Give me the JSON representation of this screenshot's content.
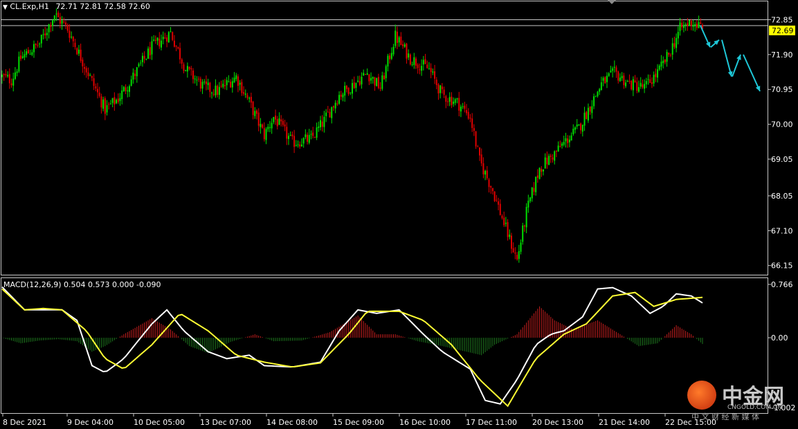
{
  "colors": {
    "background": "#000000",
    "frame": "#c8c8c8",
    "bull": "#00e000",
    "bear": "#e00000",
    "macd_line": "#ffffff",
    "signal_line": "#ffff33",
    "hist_pos": "#c81e1e",
    "hist_neg": "#1e781e",
    "price_tag": "#ffff00",
    "arrow": "#1ec8d8",
    "hline": "#c8c8c8"
  },
  "price_panel": {
    "symbol_label": "CL.Exp,H1",
    "ohlc_text": "72.71 72.81 72.58 72.60",
    "current_price": "72.69",
    "y_ticks": [
      "72.85",
      "71.90",
      "70.95",
      "70.00",
      "69.05",
      "68.05",
      "67.10",
      "66.15"
    ],
    "icons": {
      "menu": "triangle-down-icon"
    }
  },
  "macd_panel": {
    "label": "MACD(12,26,9) 0.504 0.573 0.000 -0.090",
    "y_ticks": [
      "0.766",
      "0.00",
      "-1.002"
    ]
  },
  "x_axis": {
    "ticks": [
      "8 Dec 2021",
      "9 Dec 04:00",
      "10 Dec 05:00",
      "13 Dec 07:00",
      "14 Dec 08:00",
      "15 Dec 09:00",
      "16 Dec 10:00",
      "17 Dec 11:00",
      "20 Dec 13:00",
      "21 Dec 14:00",
      "22 Dec 15:00"
    ]
  },
  "watermark": {
    "brand": "中金网",
    "domain": "CNGOLD.COM.CN",
    "tagline": "中 文 财 经 新 媒 体"
  },
  "chart_data": [
    {
      "type": "candlestick",
      "title": "CL.Exp,H1",
      "timeframe": "H1",
      "ylim": [
        65.9,
        73.35
      ],
      "x_labels": [
        "8 Dec 2021",
        "9 Dec 04:00",
        "10 Dec 05:00",
        "13 Dec 07:00",
        "14 Dec 08:00",
        "15 Dec 09:00",
        "16 Dec 10:00",
        "17 Dec 11:00",
        "20 Dec 13:00",
        "21 Dec 14:00",
        "22 Dec 15:00"
      ],
      "last_ohlc": {
        "open": 72.71,
        "high": 72.81,
        "low": 72.58,
        "close": 72.6
      },
      "horizontal_lines": [
        72.85,
        72.69
      ],
      "close_path": [
        [
          0,
          71.3
        ],
        [
          5,
          71.2
        ],
        [
          10,
          71.8
        ],
        [
          20,
          72.2
        ],
        [
          28,
          73.0
        ],
        [
          35,
          72.6
        ],
        [
          45,
          71.5
        ],
        [
          55,
          70.4
        ],
        [
          62,
          70.7
        ],
        [
          70,
          71.3
        ],
        [
          80,
          72.1
        ],
        [
          90,
          72.5
        ],
        [
          98,
          71.5
        ],
        [
          108,
          71.0
        ],
        [
          115,
          70.9
        ],
        [
          125,
          71.3
        ],
        [
          132,
          70.6
        ],
        [
          140,
          69.7
        ],
        [
          145,
          70.2
        ],
        [
          155,
          69.5
        ],
        [
          165,
          69.6
        ],
        [
          172,
          70.1
        ],
        [
          180,
          70.8
        ],
        [
          188,
          71.1
        ],
        [
          195,
          71.4
        ],
        [
          202,
          71.0
        ],
        [
          210,
          72.4
        ],
        [
          218,
          71.8
        ],
        [
          228,
          71.5
        ],
        [
          235,
          70.8
        ],
        [
          243,
          70.6
        ],
        [
          250,
          70.2
        ],
        [
          255,
          69.0
        ],
        [
          262,
          68.2
        ],
        [
          270,
          67.0
        ],
        [
          275,
          66.3
        ],
        [
          280,
          67.6
        ],
        [
          287,
          68.8
        ],
        [
          295,
          69.2
        ],
        [
          302,
          69.6
        ],
        [
          308,
          69.9
        ],
        [
          313,
          70.4
        ],
        [
          320,
          71.1
        ],
        [
          327,
          71.4
        ],
        [
          335,
          71.1
        ],
        [
          343,
          71.0
        ],
        [
          350,
          71.4
        ],
        [
          356,
          71.9
        ],
        [
          362,
          72.6
        ],
        [
          368,
          72.8
        ],
        [
          373,
          72.65
        ]
      ],
      "forecast_arrows": [
        [
          [
            72.69,
            72.1
          ],
          [
            72.1,
            72.3
          ]
        ],
        [
          [
            72.3,
            71.3
          ],
          [
            71.3,
            71.9
          ]
        ],
        [
          [
            71.9,
            70.9
          ]
        ]
      ]
    },
    {
      "type": "macd",
      "title": "MACD(12,26,9)",
      "params": [
        12,
        26,
        9
      ],
      "values": {
        "macd": 0.504,
        "signal": 0.573,
        "histogram": 0.0,
        "extra": -0.09
      },
      "ylim": [
        -1.002,
        0.766
      ],
      "macd_path": [
        [
          0,
          0.73
        ],
        [
          12,
          0.4
        ],
        [
          22,
          0.4
        ],
        [
          32,
          0.4
        ],
        [
          40,
          0.25
        ],
        [
          48,
          -0.4
        ],
        [
          55,
          -0.5
        ],
        [
          65,
          -0.3
        ],
        [
          80,
          0.2
        ],
        [
          88,
          0.4
        ],
        [
          97,
          0.1
        ],
        [
          110,
          -0.2
        ],
        [
          120,
          -0.3
        ],
        [
          132,
          -0.25
        ],
        [
          140,
          -0.4
        ],
        [
          155,
          -0.42
        ],
        [
          170,
          -0.35
        ],
        [
          180,
          0.1
        ],
        [
          190,
          0.4
        ],
        [
          200,
          0.35
        ],
        [
          212,
          0.4
        ],
        [
          225,
          0.05
        ],
        [
          235,
          -0.2
        ],
        [
          250,
          -0.45
        ],
        [
          258,
          -0.9
        ],
        [
          266,
          -0.95
        ],
        [
          275,
          -0.6
        ],
        [
          285,
          -0.1
        ],
        [
          293,
          0.05
        ],
        [
          300,
          0.1
        ],
        [
          310,
          0.3
        ],
        [
          318,
          0.7
        ],
        [
          326,
          0.72
        ],
        [
          336,
          0.6
        ],
        [
          346,
          0.35
        ],
        [
          353,
          0.45
        ],
        [
          360,
          0.63
        ],
        [
          368,
          0.6
        ],
        [
          374,
          0.5
        ]
      ],
      "signal_path": [
        [
          0,
          0.7
        ],
        [
          12,
          0.4
        ],
        [
          22,
          0.42
        ],
        [
          32,
          0.4
        ],
        [
          45,
          0.1
        ],
        [
          55,
          -0.3
        ],
        [
          65,
          -0.45
        ],
        [
          80,
          -0.1
        ],
        [
          95,
          0.35
        ],
        [
          110,
          0.1
        ],
        [
          125,
          -0.25
        ],
        [
          140,
          -0.35
        ],
        [
          155,
          -0.42
        ],
        [
          170,
          -0.36
        ],
        [
          185,
          0.05
        ],
        [
          195,
          0.38
        ],
        [
          212,
          0.38
        ],
        [
          225,
          0.25
        ],
        [
          240,
          -0.1
        ],
        [
          255,
          -0.6
        ],
        [
          270,
          -0.98
        ],
        [
          285,
          -0.3
        ],
        [
          300,
          0.05
        ],
        [
          312,
          0.2
        ],
        [
          326,
          0.6
        ],
        [
          338,
          0.65
        ],
        [
          348,
          0.45
        ],
        [
          360,
          0.55
        ],
        [
          374,
          0.58
        ]
      ],
      "histogram_path": [
        [
          0,
          0.0
        ],
        [
          10,
          -0.08
        ],
        [
          20,
          -0.04
        ],
        [
          30,
          -0.02
        ],
        [
          40,
          -0.05
        ],
        [
          48,
          -0.2
        ],
        [
          55,
          -0.12
        ],
        [
          65,
          0.05
        ],
        [
          80,
          0.28
        ],
        [
          90,
          0.12
        ],
        [
          100,
          -0.12
        ],
        [
          110,
          -0.22
        ],
        [
          122,
          -0.06
        ],
        [
          135,
          0.05
        ],
        [
          145,
          -0.05
        ],
        [
          160,
          -0.04
        ],
        [
          175,
          0.08
        ],
        [
          190,
          0.32
        ],
        [
          200,
          0.05
        ],
        [
          210,
          0.05
        ],
        [
          222,
          -0.05
        ],
        [
          235,
          -0.12
        ],
        [
          248,
          -0.2
        ],
        [
          256,
          -0.25
        ],
        [
          263,
          -0.1
        ],
        [
          275,
          0.05
        ],
        [
          287,
          0.45
        ],
        [
          295,
          0.25
        ],
        [
          305,
          0.12
        ],
        [
          318,
          0.25
        ],
        [
          330,
          0.05
        ],
        [
          340,
          -0.12
        ],
        [
          350,
          -0.08
        ],
        [
          360,
          0.18
        ],
        [
          368,
          0.05
        ],
        [
          374,
          -0.09
        ]
      ]
    }
  ]
}
